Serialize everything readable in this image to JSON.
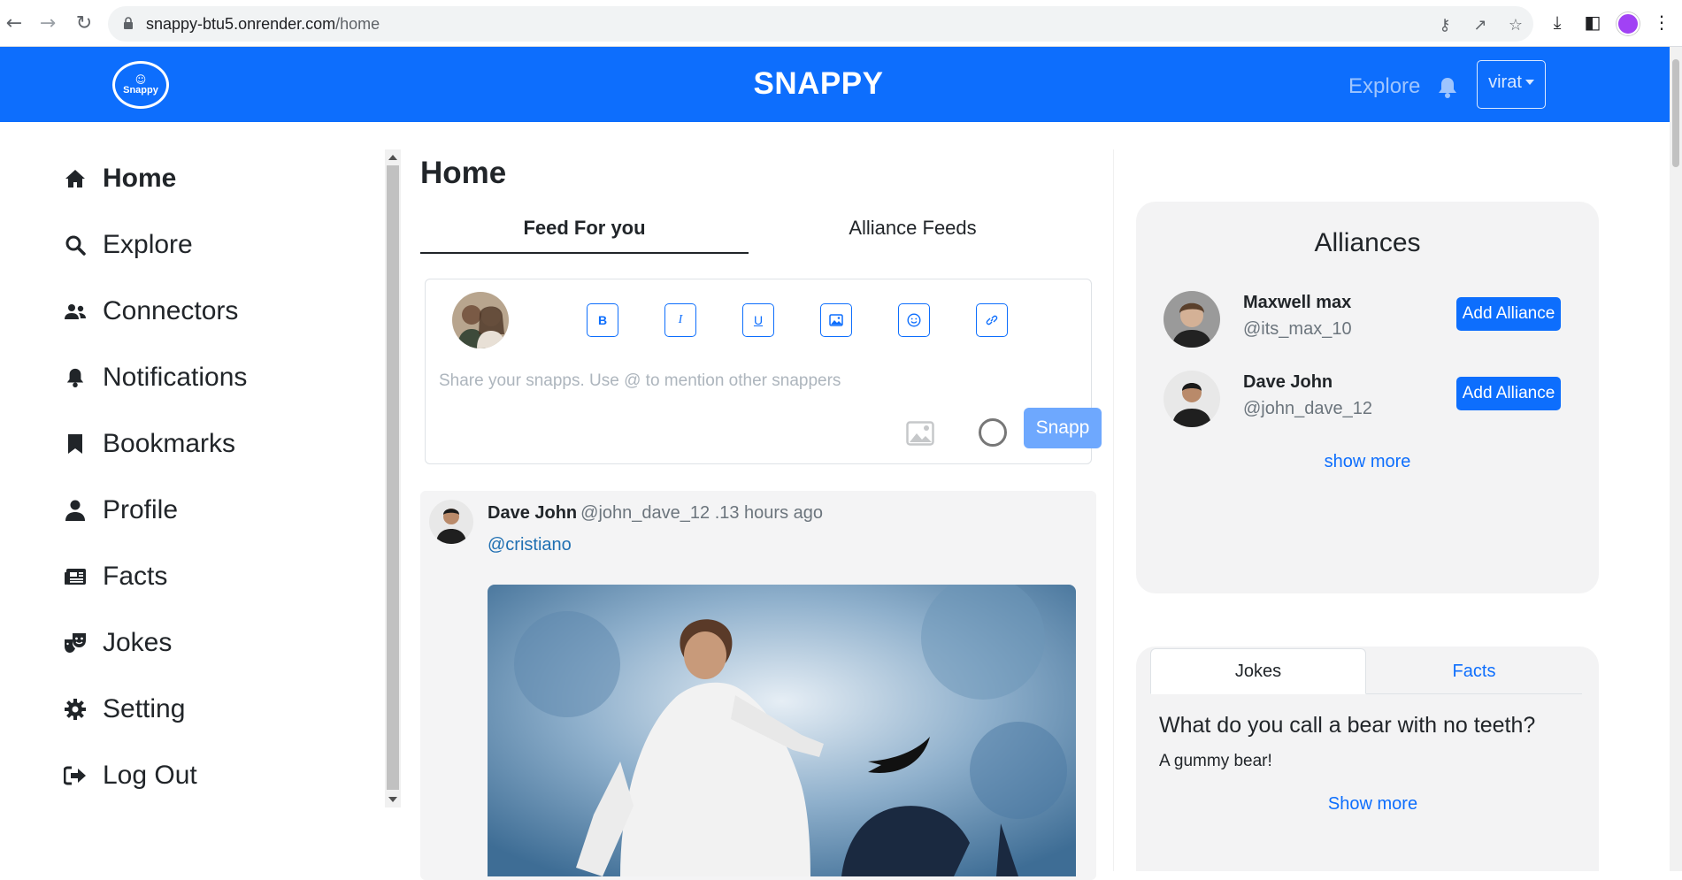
{
  "browser": {
    "url_host": "snappy-btu5.onrender.com",
    "url_path": "/home",
    "icons": [
      "back-icon",
      "forward-icon",
      "reload-icon",
      "lock-icon",
      "key-icon",
      "share-icon",
      "star-icon",
      "download-icon",
      "sidepanel-icon",
      "profile-avatar",
      "menu-icon"
    ]
  },
  "navbar": {
    "logo_text": "Snappy",
    "brand": "SNAPPY",
    "explore": "Explore",
    "user": "virat",
    "bg_color": "#0d6efd"
  },
  "sidebar": {
    "items": [
      {
        "label": "Home",
        "icon": "home-icon",
        "active": true
      },
      {
        "label": "Explore",
        "icon": "search-icon"
      },
      {
        "label": "Connectors",
        "icon": "users-icon"
      },
      {
        "label": "Notifications",
        "icon": "bell-icon"
      },
      {
        "label": "Bookmarks",
        "icon": "bookmark-icon"
      },
      {
        "label": "Profile",
        "icon": "user-icon"
      },
      {
        "label": "Facts",
        "icon": "newspaper-icon"
      },
      {
        "label": "Jokes",
        "icon": "masks-icon"
      },
      {
        "label": "Setting",
        "icon": "gear-icon"
      },
      {
        "label": "Log Out",
        "icon": "logout-icon"
      }
    ]
  },
  "feed": {
    "title": "Home",
    "tabs": [
      "Feed For you",
      "Alliance Feeds"
    ],
    "composer": {
      "placeholder": "Share your snapps. Use @ to mention other snappers",
      "format_buttons": [
        "bold-icon",
        "italic-icon",
        "underline-icon",
        "image-icon",
        "emoji-icon",
        "link-icon"
      ],
      "submit": "Snapp"
    },
    "post": {
      "name": "Dave John",
      "meta": "@john_dave_12 .13 hours ago",
      "mention": "@cristiano"
    }
  },
  "alliances": {
    "title": "Alliances",
    "people": [
      {
        "name": "Maxwell max",
        "handle": "@its_max_10",
        "button": "Add Alliance"
      },
      {
        "name": "Dave John",
        "handle": "@john_dave_12",
        "button": "Add Alliance"
      }
    ],
    "show_more": "show more"
  },
  "jokes_facts": {
    "tabs": [
      "Jokes",
      "Facts"
    ],
    "question": "What do you call a bear with no teeth?",
    "answer": "A gummy bear!",
    "show_more": "Show more"
  }
}
